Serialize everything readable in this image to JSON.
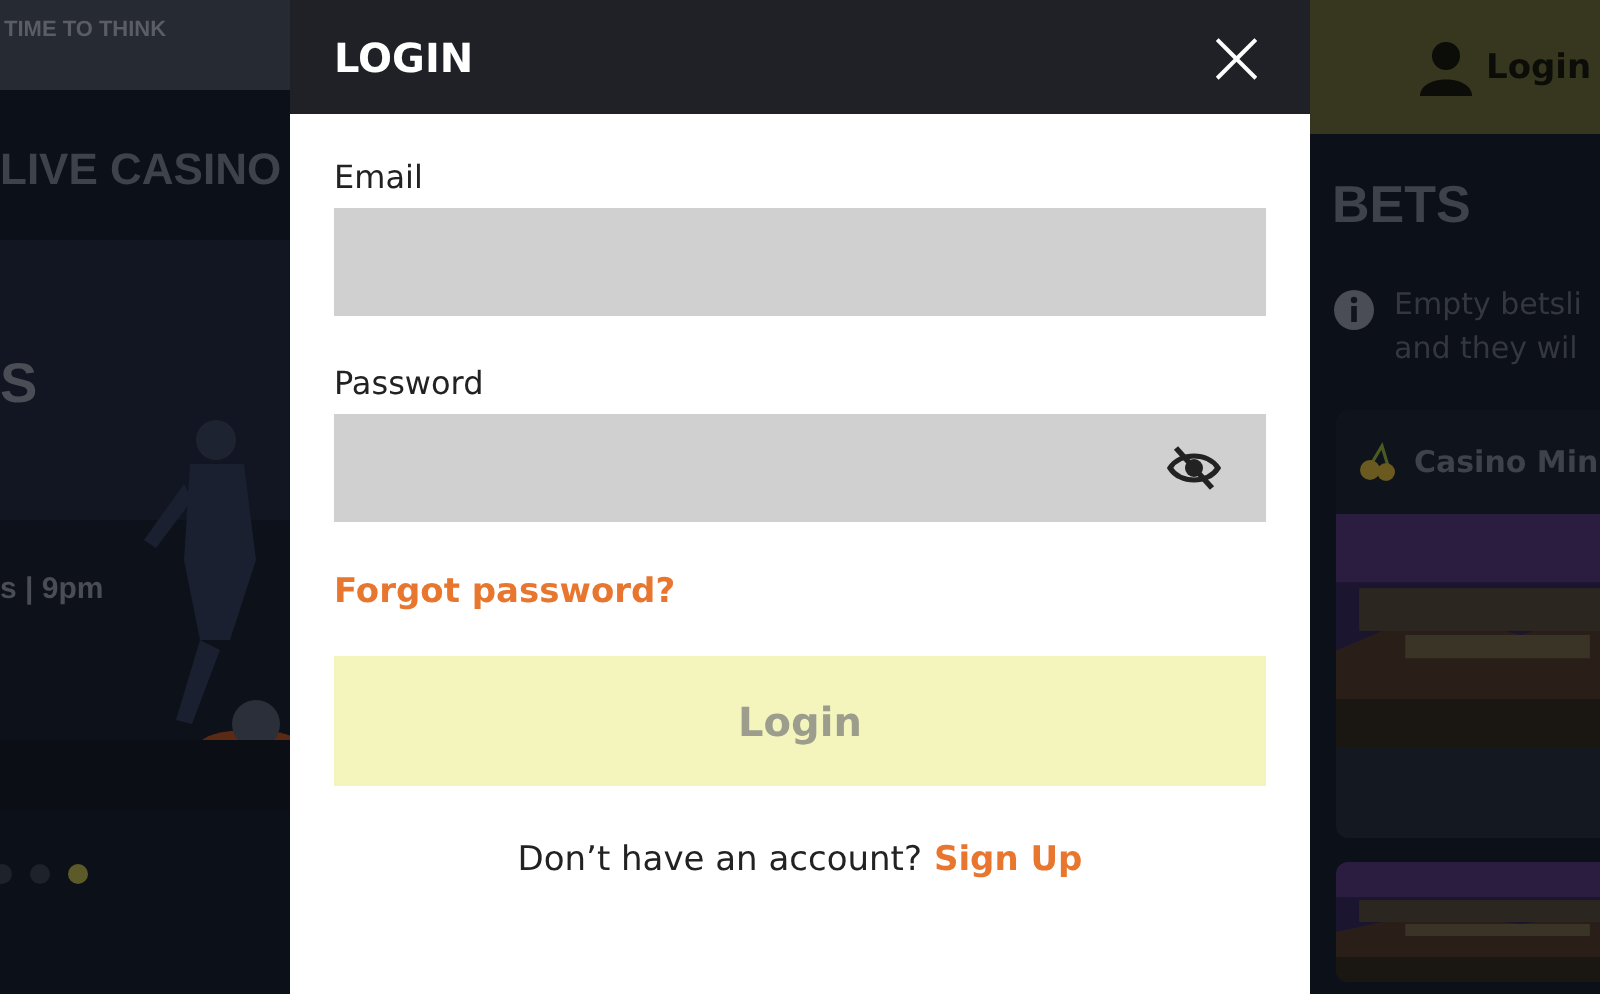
{
  "background_left": {
    "logo": "TIME TO THINK",
    "section_title": "LIVE CASINO",
    "hero": {
      "kind": "picture",
      "headline": "S",
      "subline": "s | 9pm"
    },
    "carousel_dots": [
      {
        "selected": false
      },
      {
        "selected": false
      },
      {
        "selected": true
      }
    ]
  },
  "background_right": {
    "login_link": "Login",
    "betslip_title": "BETS",
    "betslip_message": [
      "Empty betsli",
      "and they wil"
    ],
    "cards": [
      {
        "title": "Casino Min",
        "kind": "picture"
      },
      {
        "kind": "picture"
      }
    ]
  },
  "modal": {
    "title": "LOGIN",
    "close": "×",
    "fields": [
      {
        "label": "Email",
        "kind": "text"
      },
      {
        "label": "Password",
        "kind": "password"
      }
    ],
    "forgot_link": "Forgot password?",
    "submit": {
      "label": "Login",
      "disabled": true
    },
    "signup_prompt": "Don’t have an account?",
    "signup_link": "Sign Up"
  }
}
